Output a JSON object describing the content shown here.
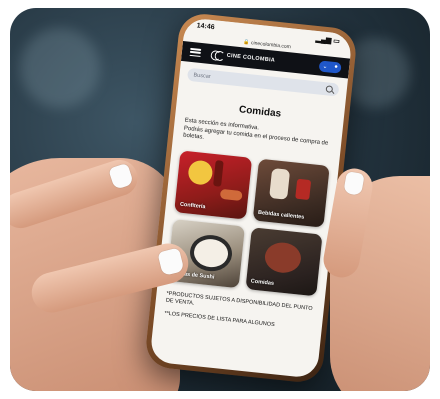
{
  "status": {
    "time": "14:46",
    "url": "cinecolombia.com"
  },
  "brand": {
    "name": "CINE COLOMBIA"
  },
  "search": {
    "placeholder": "Buscar"
  },
  "page": {
    "title": "Comidas",
    "intro": "Esta sección es informativa.\nPodrás agregar tu comida en el proceso de compra de boletas."
  },
  "categories": [
    {
      "label": "Confitería"
    },
    {
      "label": "Bebidas calientes"
    },
    {
      "label": "Barras de Sushi"
    },
    {
      "label": "Comidas"
    }
  ],
  "footnotes": [
    "*PRODUCTOS SUJETOS A DISPONIBILIDAD DEL PUNTO DE VENTA.",
    "**LOS PRECIOS DE LISTA PARA ALGUNOS"
  ],
  "colors": {
    "nav": "#0f1116",
    "accent": "#1f57c9",
    "screen": "#f6f4f0"
  }
}
